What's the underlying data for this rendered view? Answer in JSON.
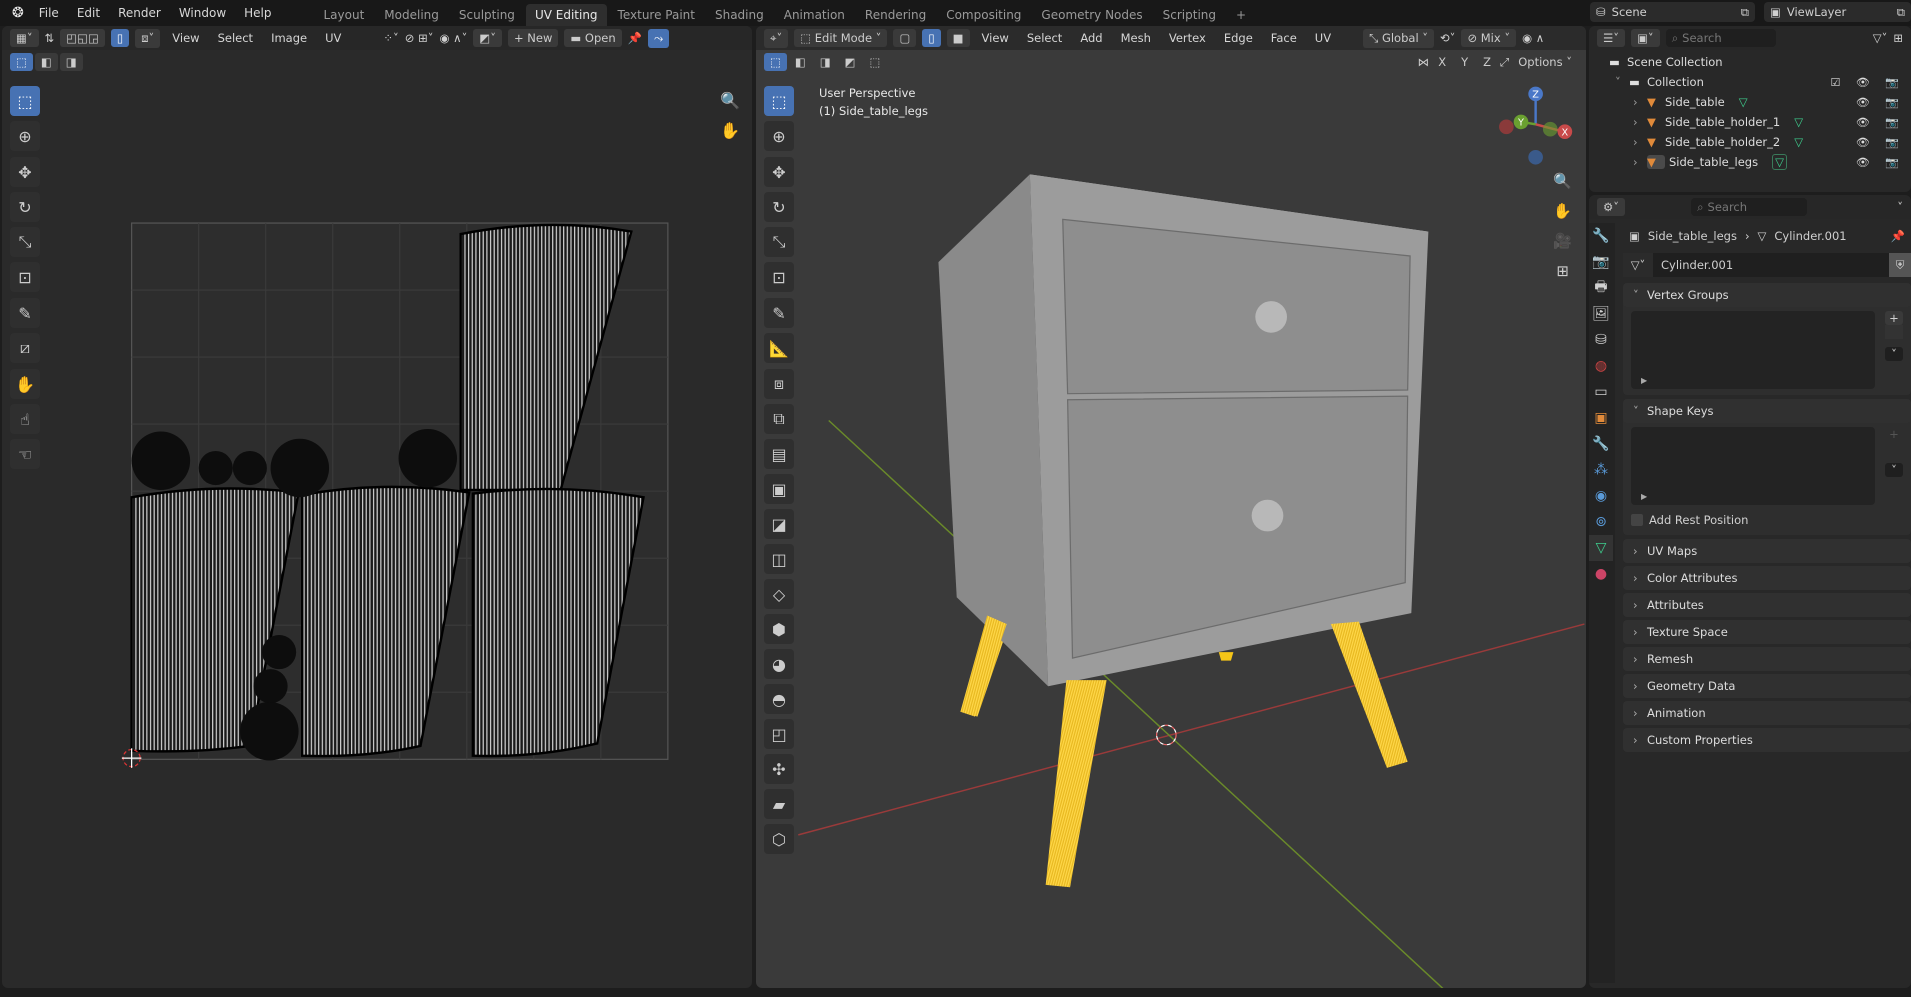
{
  "menubar": {
    "items": [
      "File",
      "Edit",
      "Render",
      "Window",
      "Help"
    ],
    "workspaces": [
      "Layout",
      "Modeling",
      "Sculpting",
      "UV Editing",
      "Texture Paint",
      "Shading",
      "Animation",
      "Rendering",
      "Compositing",
      "Geometry Nodes",
      "Scripting",
      "+"
    ],
    "active_workspace": "UV Editing",
    "scene": "Scene",
    "view_layer": "ViewLayer"
  },
  "uv_editor": {
    "menus": [
      "View",
      "Select",
      "Image",
      "UV"
    ],
    "new_label": "New",
    "open_label": "Open"
  },
  "viewport": {
    "mode": "Edit Mode",
    "menus": [
      "View",
      "Select",
      "Add",
      "Mesh",
      "Vertex",
      "Edge",
      "Face",
      "UV"
    ],
    "orientation": "Global",
    "pivot": "Mix",
    "options_label": "Options",
    "axes": [
      "X",
      "Y",
      "Z"
    ],
    "overlay_title": "User Perspective",
    "overlay_object": "(1) Side_table_legs",
    "gizmo": {
      "x": "X",
      "y": "Y",
      "z": "Z"
    }
  },
  "outliner": {
    "search_placeholder": "Search",
    "scene_collection": "Scene Collection",
    "collection": "Collection",
    "objects": [
      "Side_table",
      "Side_table_holder_1",
      "Side_table_holder_2",
      "Side_table_legs"
    ]
  },
  "properties": {
    "search_placeholder": "Search",
    "breadcrumb_object": "Side_table_legs",
    "breadcrumb_mesh": "Cylinder.001",
    "mesh_name": "Cylinder.001",
    "vertex_groups": "Vertex Groups",
    "shape_keys": "Shape Keys",
    "add_rest_position": "Add Rest Position",
    "collapsed_panels": [
      "UV Maps",
      "Color Attributes",
      "Attributes",
      "Texture Space",
      "Remesh",
      "Geometry Data",
      "Animation",
      "Custom Properties"
    ]
  },
  "colors": {
    "accent": "#4772b3",
    "selected_edges": "#f5c518",
    "mesh_green": "#3ecf8e",
    "object_orange": "#e08a3a"
  }
}
